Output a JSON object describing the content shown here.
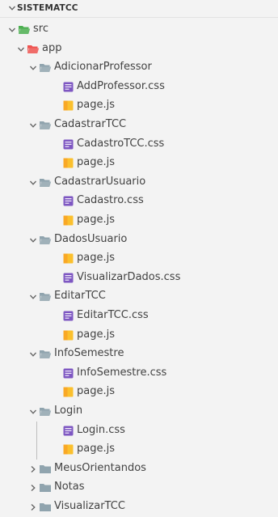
{
  "explorer": {
    "title": "SISTEMATCC",
    "items": [
      {
        "label": "src",
        "kind": "folder-src",
        "icon": "src-folder-icon",
        "depth": 1,
        "state": "expanded"
      },
      {
        "label": "app",
        "kind": "folder-app",
        "icon": "app-folder-icon",
        "depth": 2,
        "state": "expanded"
      },
      {
        "label": "AdicionarProfessor",
        "kind": "folder",
        "icon": "folder-open-icon",
        "depth": 3,
        "state": "expanded"
      },
      {
        "label": "AddProfessor.css",
        "kind": "css",
        "icon": "css-file-icon",
        "depth": 4
      },
      {
        "label": "page.js",
        "kind": "js",
        "icon": "js-file-icon",
        "depth": 4
      },
      {
        "label": "CadastrarTCC",
        "kind": "folder",
        "icon": "folder-open-icon",
        "depth": 3,
        "state": "expanded"
      },
      {
        "label": "CadastroTCC.css",
        "kind": "css",
        "icon": "css-file-icon",
        "depth": 4
      },
      {
        "label": "page.js",
        "kind": "js",
        "icon": "js-file-icon",
        "depth": 4
      },
      {
        "label": "CadastrarUsuario",
        "kind": "folder",
        "icon": "folder-open-icon",
        "depth": 3,
        "state": "expanded"
      },
      {
        "label": "Cadastro.css",
        "kind": "css",
        "icon": "css-file-icon",
        "depth": 4
      },
      {
        "label": "page.js",
        "kind": "js",
        "icon": "js-file-icon",
        "depth": 4
      },
      {
        "label": "DadosUsuario",
        "kind": "folder",
        "icon": "folder-open-icon",
        "depth": 3,
        "state": "expanded"
      },
      {
        "label": "page.js",
        "kind": "js",
        "icon": "js-file-icon",
        "depth": 4
      },
      {
        "label": "VisualizarDados.css",
        "kind": "css",
        "icon": "css-file-icon",
        "depth": 4
      },
      {
        "label": "EditarTCC",
        "kind": "folder",
        "icon": "folder-open-icon",
        "depth": 3,
        "state": "expanded"
      },
      {
        "label": "EditarTCC.css",
        "kind": "css",
        "icon": "css-file-icon",
        "depth": 4
      },
      {
        "label": "page.js",
        "kind": "js",
        "icon": "js-file-icon",
        "depth": 4
      },
      {
        "label": "InfoSemestre",
        "kind": "folder",
        "icon": "folder-open-icon",
        "depth": 3,
        "state": "expanded"
      },
      {
        "label": "InfoSemestre.css",
        "kind": "css",
        "icon": "css-file-icon",
        "depth": 4
      },
      {
        "label": "page.js",
        "kind": "js",
        "icon": "js-file-icon",
        "depth": 4
      },
      {
        "label": "Login",
        "kind": "folder",
        "icon": "folder-open-icon",
        "depth": 3,
        "state": "expanded"
      },
      {
        "label": "Login.css",
        "kind": "css",
        "icon": "css-file-icon",
        "depth": 4
      },
      {
        "label": "page.js",
        "kind": "js",
        "icon": "js-file-icon",
        "depth": 4
      },
      {
        "label": "MeusOrientandos",
        "kind": "folder",
        "icon": "folder-closed-icon",
        "depth": 3,
        "state": "collapsed"
      },
      {
        "label": "Notas",
        "kind": "folder",
        "icon": "folder-closed-icon",
        "depth": 3,
        "state": "collapsed"
      },
      {
        "label": "VisualizarTCC",
        "kind": "folder",
        "icon": "folder-closed-icon",
        "depth": 3,
        "state": "collapsed"
      }
    ]
  },
  "colors": {
    "background": "#f3f3f3",
    "folder": "#90a4ae",
    "src_folder": "#4caf50",
    "app_folder": "#ef5350",
    "css_file": "#7e57c2",
    "js_file": "#fbc02d",
    "text": "#424242",
    "chevron": "#616161"
  }
}
